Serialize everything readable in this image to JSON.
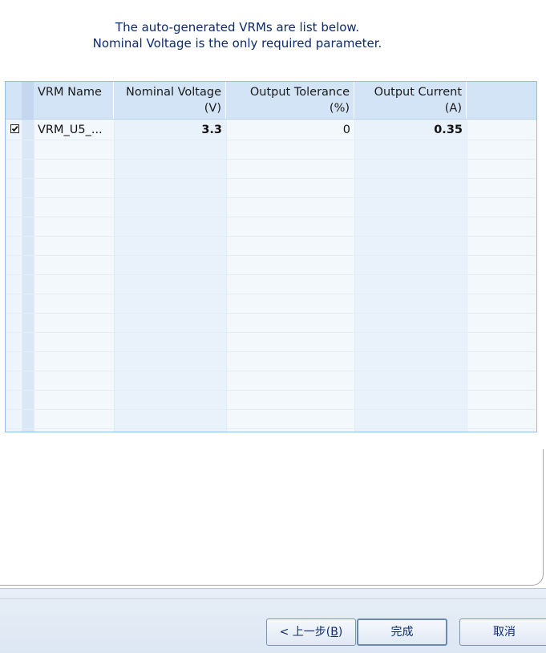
{
  "intro": {
    "line1": "The auto-generated VRMs are list below.",
    "line2": "Nominal Voltage is the only required parameter."
  },
  "table": {
    "columns": [
      {
        "line1": "VRM Name",
        "line2": ""
      },
      {
        "line1": "Nominal Voltage",
        "line2": "(V)"
      },
      {
        "line1": "Output Tolerance",
        "line2": "(%)"
      },
      {
        "line1": "Output Current",
        "line2": "(A)"
      }
    ],
    "rows": [
      {
        "checked": true,
        "name": "VRM_U5_...",
        "nominal_voltage": "3.3",
        "output_tolerance": "0",
        "output_current": "0.35"
      }
    ]
  },
  "footer": {
    "back_label": "< 上一步(",
    "back_key": "B",
    "back_close": ")",
    "finish_label": "完成",
    "cancel_label": "取消"
  },
  "colors": {
    "grid_border": "#99bbe8",
    "header_bg": "#d4e4f7",
    "intro_text": "#0d2a6b"
  }
}
